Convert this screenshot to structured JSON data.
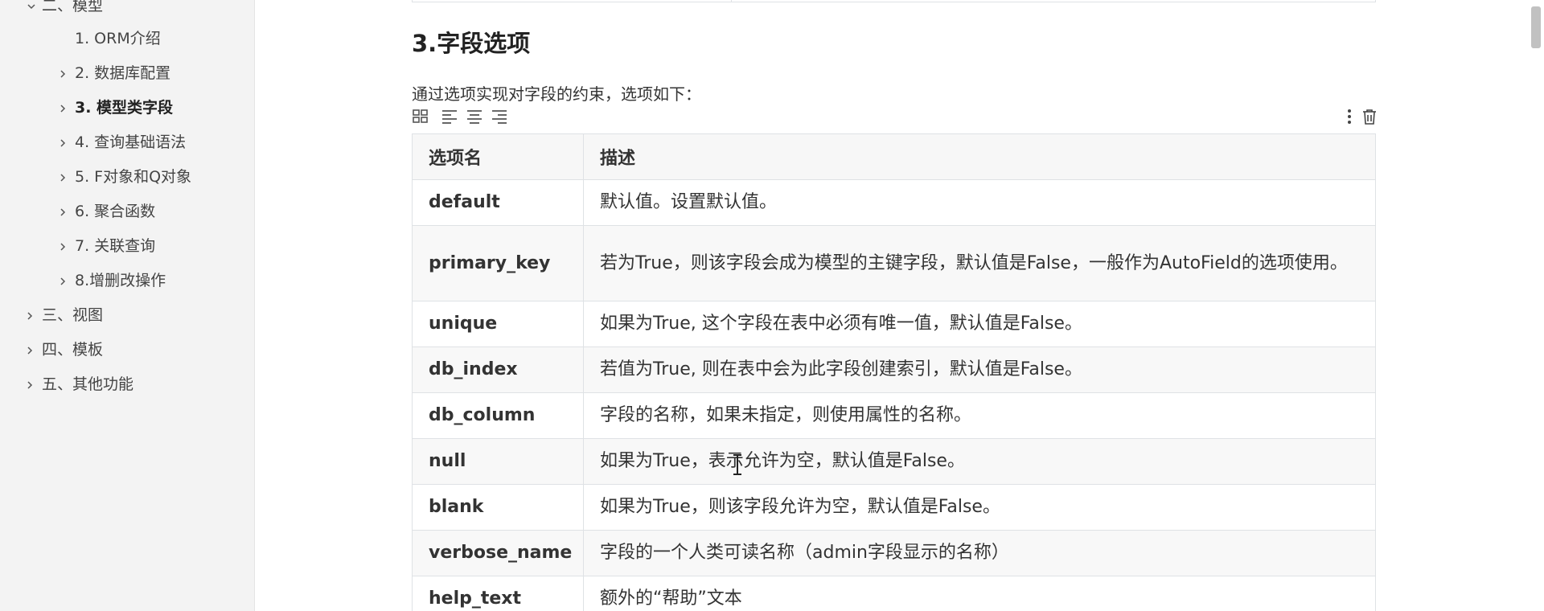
{
  "sidebar": {
    "items": [
      {
        "label": "二、模型",
        "icon": "chevron-down-icon",
        "active": false
      },
      {
        "label": "1. ORM介绍",
        "icon": "",
        "active": false
      },
      {
        "label": "2. 数据库配置",
        "icon": "chevron-right-icon",
        "active": false
      },
      {
        "label": "3. 模型类字段",
        "icon": "chevron-right-icon",
        "active": true
      },
      {
        "label": "4. 查询基础语法",
        "icon": "chevron-right-icon",
        "active": false
      },
      {
        "label": "5. F对象和Q对象",
        "icon": "chevron-right-icon",
        "active": false
      },
      {
        "label": "6. 聚合函数",
        "icon": "chevron-right-icon",
        "active": false
      },
      {
        "label": "7. 关联查询",
        "icon": "chevron-right-icon",
        "active": false
      },
      {
        "label": "8.增删改操作",
        "icon": "chevron-right-icon",
        "active": false
      },
      {
        "label": "三、视图",
        "icon": "chevron-right-icon",
        "active": false
      },
      {
        "label": "四、模板",
        "icon": "chevron-right-icon",
        "active": false
      },
      {
        "label": "五、其他功能",
        "icon": "chevron-right-icon",
        "active": false
      }
    ]
  },
  "main": {
    "section_title": "3.字段选项",
    "intro": "通过选项实现对字段的约束，选项如下：",
    "toolbar": {
      "left_icons": [
        "table-grid-icon",
        "align-left-icon",
        "align-center-icon",
        "align-right-icon"
      ],
      "right_icons": [
        "more-vertical-icon",
        "trash-icon"
      ]
    },
    "table": {
      "headers": [
        "选项名",
        "描述"
      ],
      "rows": [
        {
          "name": "default",
          "desc": "默认值。设置默认值。"
        },
        {
          "name": "primary_key",
          "desc": "若为True，则该字段会成为模型的主键字段，默认值是False，一般作为AutoField的选项使用。"
        },
        {
          "name": "unique",
          "desc": "如果为True, 这个字段在表中必须有唯一值，默认值是False。"
        },
        {
          "name": "db_index",
          "desc": "若值为True, 则在表中会为此字段创建索引，默认值是False。"
        },
        {
          "name": "db_column",
          "desc": "字段的名称，如果未指定，则使用属性的名称。"
        },
        {
          "name": "null",
          "desc": "如果为True，表示允许为空，默认值是False。"
        },
        {
          "name": "blank",
          "desc": "如果为True，则该字段允许为空，默认值是False。"
        },
        {
          "name": "verbose_name",
          "desc": "字段的一个人类可读名称（admin字段显示的名称）"
        },
        {
          "name": "help_text",
          "desc": "额外的“帮助”文本"
        }
      ]
    }
  },
  "colors": {
    "sidebar_bg": "#f3f3f3",
    "table_border": "#dfe2e5",
    "text": "#333333"
  }
}
